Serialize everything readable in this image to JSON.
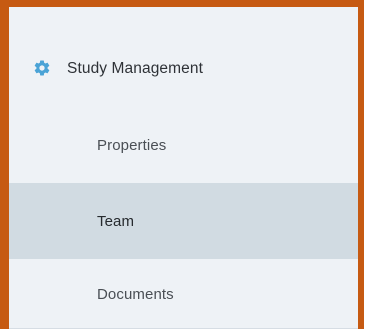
{
  "nav": {
    "header": {
      "label": "Study Management",
      "icon": "gear-icon"
    },
    "items": [
      {
        "label": "Properties",
        "selected": false
      },
      {
        "label": "Team",
        "selected": true
      },
      {
        "label": "Documents",
        "selected": false
      }
    ]
  },
  "colors": {
    "frame": "#c65a12",
    "panel": "#eef2f6",
    "selected": "#d1dbe2",
    "icon": "#4aa3d6"
  }
}
